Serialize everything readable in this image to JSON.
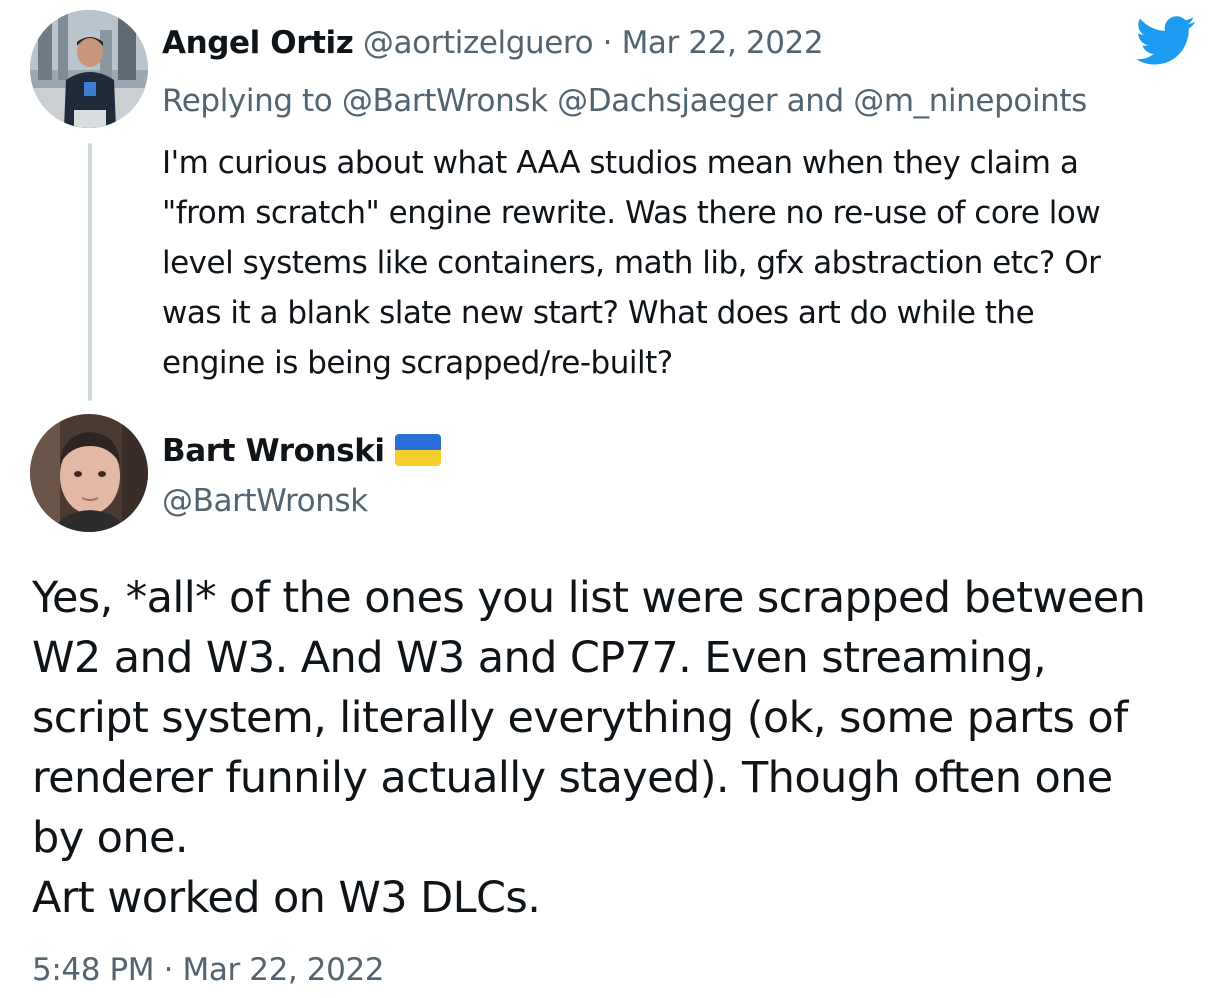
{
  "parent_tweet": {
    "author_name": "Angel Ortiz",
    "author_handle": "@aortizelguero",
    "separator": "·",
    "date": "Mar 22, 2022",
    "replying_prefix": "Replying to",
    "replying_targets": "@BartWronsk @Dachsjaeger and @m_ninepoints",
    "text_lines": [
      "I'm curious about what AAA studios mean when they claim a",
      "\"from scratch\" engine rewrite. Was there no re-use of core low",
      "level systems like containers, math lib, gfx abstraction etc? Or",
      "was it a blank slate new start? What does art do while the",
      "engine is being scrapped/re-built?"
    ]
  },
  "main_tweet": {
    "author_name": "Bart Wronski",
    "author_flag": "ukraine-flag",
    "author_handle": "@BartWronsk",
    "text_lines": [
      "Yes, *all* of the ones you list were scrapped between",
      "W2 and W3. And W3 and CP77. Even streaming,",
      "script system, literally everything (ok, some parts of",
      "renderer funnily actually stayed). Though often one",
      "by one.",
      "Art worked on W3 DLCs."
    ],
    "time": "5:48 PM",
    "separator": "·",
    "date": "Mar 22, 2022"
  },
  "icons": {
    "brand": "twitter-bird-icon"
  },
  "colors": {
    "twitter_blue": "#1d9bf0",
    "text_primary": "#0f1419",
    "text_secondary": "#536471",
    "thread_line": "#cfd9de",
    "flag_blue": "#2a6fd6",
    "flag_yellow": "#f7cf2a"
  }
}
